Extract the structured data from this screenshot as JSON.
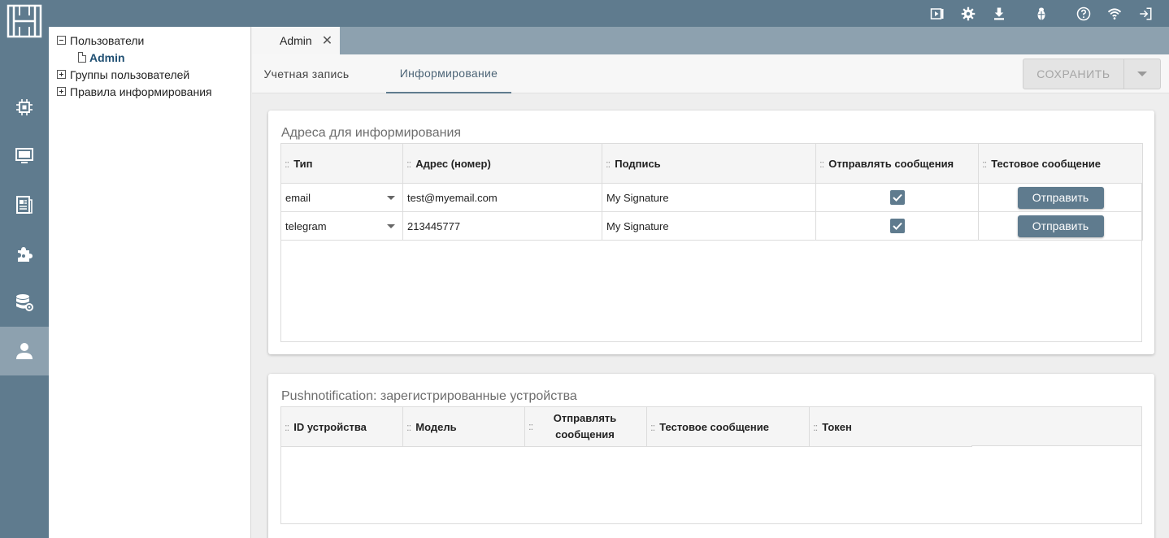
{
  "colors": {
    "accent": "#5f7b8e",
    "rail_active": "#8da1af",
    "tab_strip": "#8da1af"
  },
  "topbar": {
    "logo_icon": "h-logo",
    "icons": [
      "play-screen-icon",
      "gear-icon",
      "download-icon",
      "bug-icon",
      "help-icon",
      "wifi-icon",
      "logout-icon"
    ]
  },
  "rail": {
    "items": [
      "chip-icon",
      "monitor-icon",
      "document-list-icon",
      "puzzle-icon",
      "database-settings-icon",
      "user-icon"
    ],
    "active_index": 5
  },
  "tree": {
    "users": "Пользователи",
    "admin": "Admin",
    "groups": "Группы пользователей",
    "rules": "Правила информирования"
  },
  "doc_tab": {
    "label": "Admin",
    "close": "✕"
  },
  "subtabs": {
    "account": "Учетная запись",
    "info": "Информирование"
  },
  "save": {
    "label": "СОХРАНИТЬ"
  },
  "addresses": {
    "title": "Адреса для информирования",
    "columns": [
      {
        "handle": "::",
        "label": "Тип"
      },
      {
        "handle": "::",
        "label": "Адрес (номер)"
      },
      {
        "handle": "::",
        "label": "Подпись"
      },
      {
        "handle": "::",
        "label": "Отправлять сообщения"
      },
      {
        "handle": "::",
        "label": "Тестовое сообщение"
      }
    ],
    "rows": [
      {
        "type": "email",
        "address": "test@myemail.com",
        "signature": "My Signature",
        "send": true,
        "button": "Отправить"
      },
      {
        "type": "telegram",
        "address": "213445777",
        "signature": "My Signature",
        "send": true,
        "button": "Отправить"
      }
    ]
  },
  "push": {
    "title": "Pushnotification: зарегистрированные устройства",
    "columns": [
      {
        "handle": "::",
        "label": "ID устройства"
      },
      {
        "handle": "",
        "label": "Модель"
      },
      {
        "handle": "::",
        "label_line1": "Отправлять",
        "label_line2": "сообщения"
      },
      {
        "handle": "::",
        "label": "Тестовое сообщение"
      },
      {
        "handle": "::",
        "label": "Токен"
      }
    ]
  }
}
